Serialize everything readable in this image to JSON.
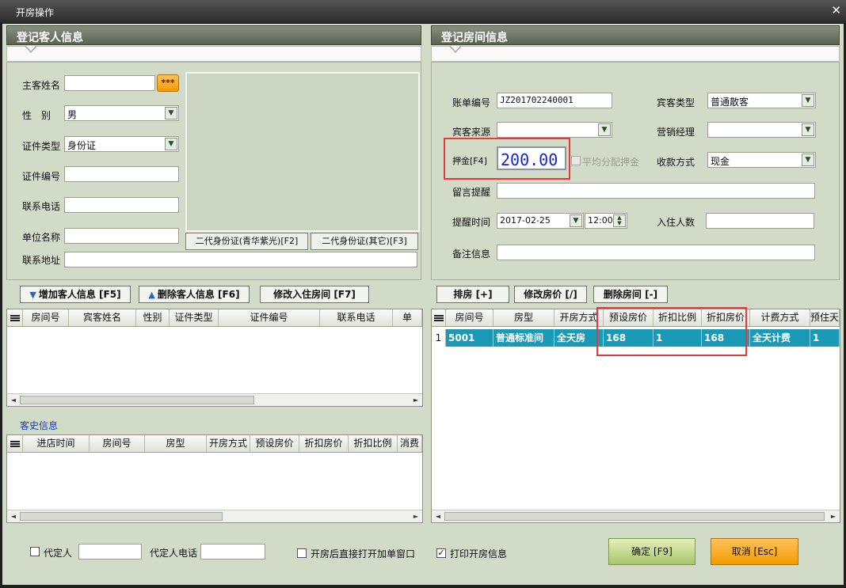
{
  "window": {
    "title": "开房操作"
  },
  "guest_panel": {
    "title": "登记客人信息",
    "name_label": "主客姓名",
    "name_value": "",
    "search_button": "***",
    "gender_label": "性　别",
    "gender_value": "男",
    "id_type_label": "证件类型",
    "id_type_value": "身份证",
    "id_no_label": "证件编号",
    "phone_label": "联系电话",
    "company_label": "单位名称",
    "address_label": "联系地址",
    "id_reader_1": "二代身份证(青华紫光)[F2]",
    "id_reader_2": "二代身份证(其它)[F3]"
  },
  "room_panel": {
    "title": "登记房间信息",
    "bill_no_label": "账单编号",
    "bill_no_value": "JZ201702240001",
    "guest_type_label": "宾客类型",
    "guest_type_value": "普通散客",
    "source_label": "宾客来源",
    "source_value": "",
    "manager_label": "营销经理",
    "manager_value": "",
    "deposit_label": "押金[F4]",
    "deposit_value": "200.00",
    "split_deposit_label": "平均分配押金",
    "payment_label": "收款方式",
    "payment_value": "现金",
    "message_label": "留言提醒",
    "remind_time_label": "提醒时间",
    "remind_date": "2017-02-25",
    "remind_clock": "12:00",
    "occupants_label": "入住人数",
    "remark_label": "备注信息"
  },
  "guest_toolbar": {
    "add": "增加客人信息 [F5]",
    "delete": "删除客人信息 [F6]",
    "modify_room": "修改入住房间 [F7]"
  },
  "room_toolbar": {
    "assign": "排房 [+]",
    "modify_price": "修改房价 [/]",
    "delete_room": "删除房间 [-]"
  },
  "guest_grid": {
    "columns": [
      "房间号",
      "宾客姓名",
      "性别",
      "证件类型",
      "证件编号",
      "联系电话",
      "单"
    ]
  },
  "history": {
    "title": "客史信息",
    "columns": [
      "进店时间",
      "房间号",
      "房型",
      "开房方式",
      "预设房价",
      "折扣房价",
      "折扣比例",
      "消费"
    ]
  },
  "room_grid": {
    "columns": [
      "房间号",
      "房型",
      "开房方式",
      "预设房价",
      "折扣比例",
      "折扣房价",
      "计费方式",
      "预住天"
    ],
    "rows": [
      {
        "index": "1",
        "room_no": "5001",
        "room_type": "普通标准间",
        "open_mode": "全天房",
        "preset_price": "168",
        "discount_ratio": "1",
        "discount_price": "168",
        "billing": "全天计费",
        "days": "1"
      }
    ]
  },
  "footer": {
    "proxy_label": "代定人",
    "proxy_phone_label": "代定人电话",
    "open_addon_label": "开房后直接打开加单窗口",
    "print_label": "打印开房信息",
    "print_checked": "✓",
    "confirm": "确定 [F9]",
    "cancel": "取消 [Esc]"
  }
}
